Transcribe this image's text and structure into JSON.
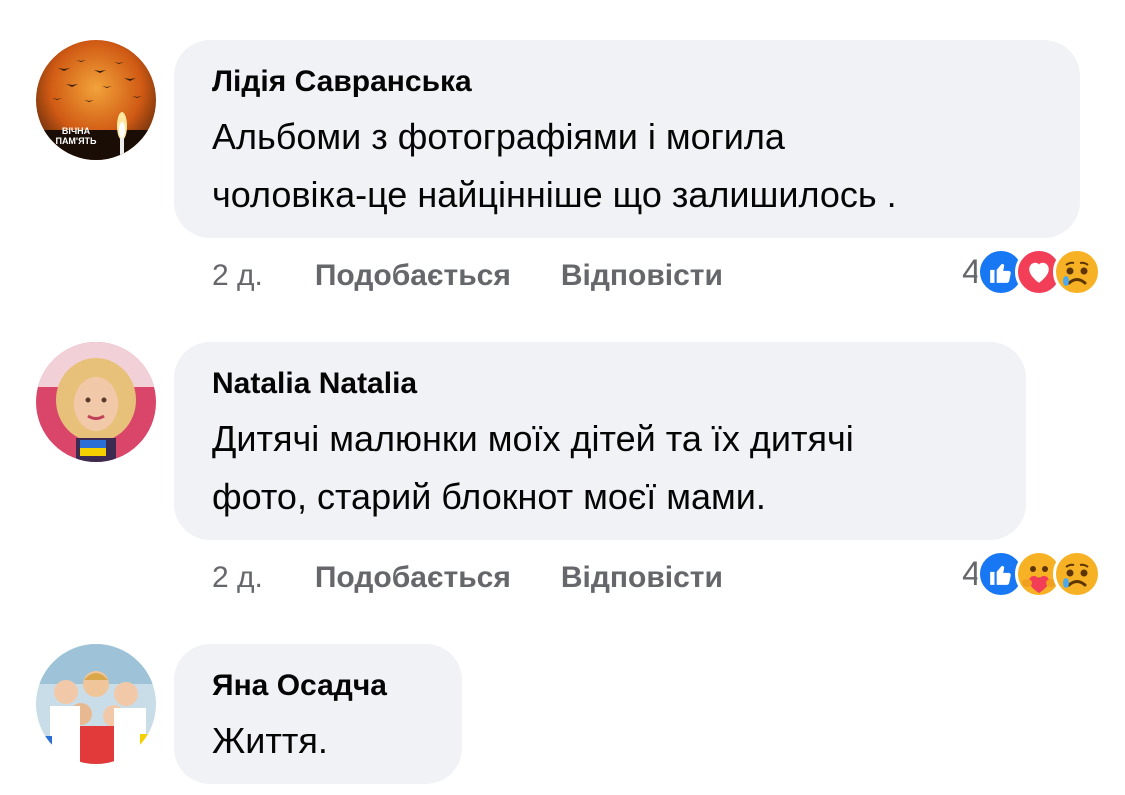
{
  "comments": [
    {
      "author": "Лідія Савранська",
      "lines": [
        "Альбоми з фотографіями і могила",
        "чоловіка-це найцінніше що залишилось ."
      ],
      "time": "2 д.",
      "like_label": "Подобається",
      "reply_label": "Відповісти",
      "reaction_count": "4",
      "reactions": [
        "like-icon",
        "love-icon",
        "sad-icon"
      ],
      "avatar_caption": [
        "ВІЧНА",
        "ПАМ'ЯТЬ"
      ]
    },
    {
      "author": "Natalia Natalia",
      "lines": [
        "Дитячі малюнки моїх дітей та їх дитячі",
        "фото, старий блокнот моєї мами."
      ],
      "time": "2 д.",
      "like_label": "Подобається",
      "reply_label": "Відповісти",
      "reaction_count": "4",
      "reactions": [
        "like-icon",
        "care-icon",
        "sad-icon"
      ]
    },
    {
      "author": "Яна Осадча",
      "lines": [
        "Життя."
      ]
    }
  ],
  "colors": {
    "bubble": "#f0f2f5",
    "meta_text": "#65676b",
    "like_blue": "#1877f2",
    "love_red": "#f33e58",
    "emoji_yellow": "#f7b125"
  }
}
